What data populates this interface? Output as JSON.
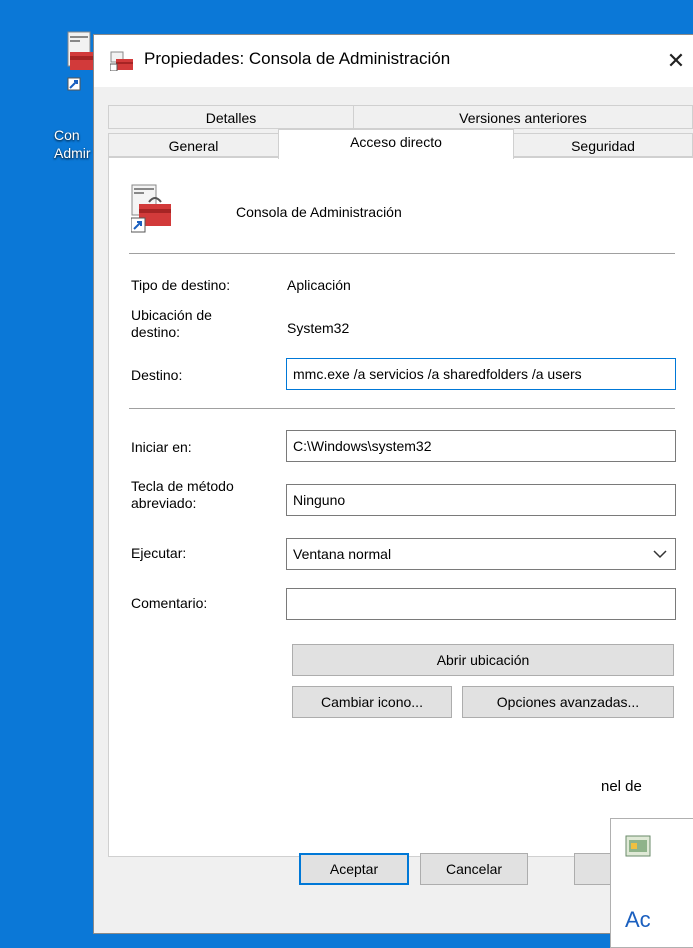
{
  "desktop": {
    "icon_label_lines": [
      "Con",
      "Admir"
    ]
  },
  "dialog": {
    "title": "Propiedades: Consola de Administración",
    "close_glyph": "✕",
    "tabs_row1": [
      "Detalles",
      "Versiones anteriores"
    ],
    "tabs_row2": [
      "General",
      "Acceso directo",
      "Seguridad"
    ],
    "active_tab": "Acceso directo"
  },
  "shortcut": {
    "name": "Consola de Administración",
    "target_type_label": "Tipo de destino:",
    "target_type_value": "Aplicación",
    "target_location_label": "Ubicación de destino:",
    "target_location_value": "System32",
    "target_label": "Destino:",
    "target_value": "mmc.exe /a servicios /a sharedfolders /a users",
    "start_in_label": "Iniciar en:",
    "start_in_value": "C:\\Windows\\system32",
    "hotkey_label": "Tecla de método abreviado:",
    "hotkey_value": "Ninguno",
    "run_label": "Ejecutar:",
    "run_value": "Ventana normal",
    "comment_label": "Comentario:",
    "comment_value": "",
    "open_location_button": "Abrir ubicación",
    "change_icon_button": "Cambiar icono...",
    "advanced_button": "Opciones avanzadas..."
  },
  "footer": {
    "ok": "Aceptar",
    "cancel": "Cancelar"
  },
  "background_window": {
    "partial_text": "nel de",
    "partial_text2": "Ac"
  }
}
